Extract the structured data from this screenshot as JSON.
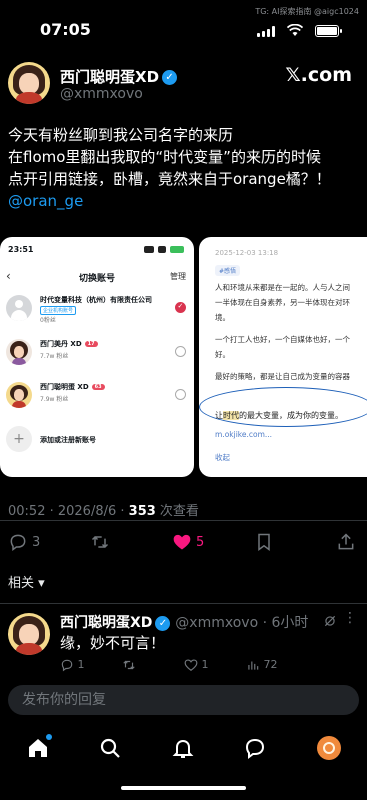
{
  "status_bar": {
    "time": "07:05",
    "watermark": "TG: AI探索指南 @aigc1024"
  },
  "post": {
    "author_name": "西门聪明蛋XD",
    "author_handle": "@xmmxovo",
    "brand": "𝕏.com",
    "text_lines": [
      "今天有粉丝聊到我公司名字的来历",
      "在flomo里翻出我取的“时代变量”的来历的时候",
      "点开引用链接，卧槽，竟然来自于orange橘？！"
    ],
    "mention": "@oran_ge",
    "timestamp": "00:52 · 2026/8/6 · ",
    "views_count": "353",
    "views_label": " 次查看",
    "actions": {
      "replies": "3",
      "retweets": "",
      "likes": "5",
      "bookmarks": ""
    },
    "related_label": "相关 ▾"
  },
  "media_left": {
    "time": "23:51",
    "back": "‹",
    "title": "切换账号",
    "manage": "管理",
    "accounts": [
      {
        "name": "时代变量科技（杭州）有限责任公司",
        "tag": "企业机构账号",
        "sub": "0粉丝",
        "badge": "",
        "selected": true
      },
      {
        "name": "西门美丹 XD",
        "tag": "",
        "sub": "7.7w 粉丝",
        "badge": "17",
        "selected": false
      },
      {
        "name": "西门聪明蛋 XD",
        "tag": "",
        "sub": "7.9w 粉丝",
        "badge": "63",
        "selected": false
      }
    ],
    "add_label": "添加或注册新账号"
  },
  "media_right": {
    "date": "2025-12-03 13:18",
    "tag": "#感悟",
    "paragraphs": [
      "人和环境从来都是在一起的。人与人之间",
      "一半体现在自身素养，另一半体现在对环",
      "境。",
      "一个打工人也好，一个自媒体也好，一个",
      "好。",
      "最好的策略，都是让自己成为变量的容器"
    ],
    "quote_prefix": "让",
    "quote_highlight": "时代",
    "quote_suffix": "的最大变量，成为你的变量。",
    "link": "m.okjike.com...",
    "collapse": "收起"
  },
  "reply": {
    "author_name": "西门聪明蛋XD",
    "author_handle": "@xmmxovo · 6小时",
    "text": "缘，妙不可言！",
    "replies": "1",
    "likes": "1",
    "views": "72"
  },
  "compose": {
    "placeholder": "发布你的回复"
  },
  "colors": {
    "accent": "#1d9bf0",
    "like": "#f91880",
    "background": "#000000"
  }
}
